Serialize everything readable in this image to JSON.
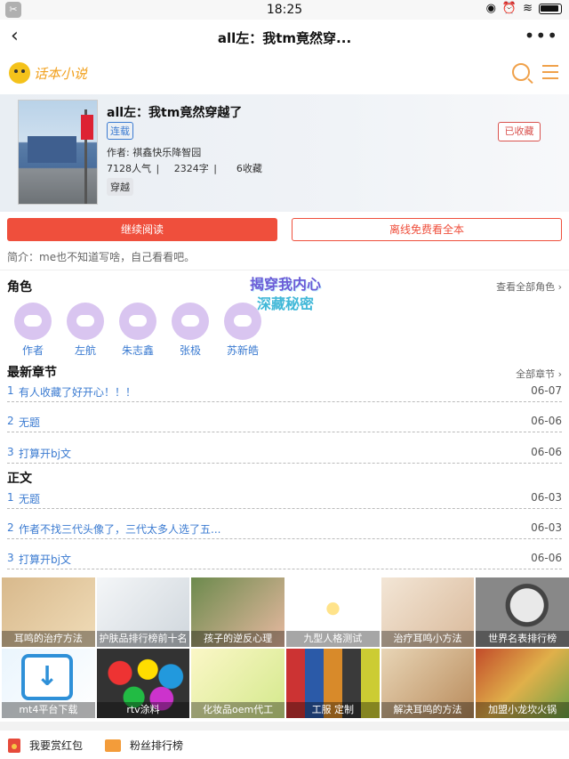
{
  "status": {
    "time": "18:25"
  },
  "nav": {
    "title": "all左：我tm竟然穿..."
  },
  "site": {
    "logo_text": "话本小说"
  },
  "book": {
    "title": "all左：我tm竟然穿越了",
    "serial_tag": "连载",
    "author": "作者: 祺鑫快乐降智园",
    "popularity": "7128人气 |",
    "words": "2324字 |",
    "favorites": "6收藏",
    "genre_tag": "穿越",
    "fav_button": "已收藏"
  },
  "actions": {
    "read": "继续阅读",
    "offline": "离线免费看全本"
  },
  "intro": "简介：me也不知道写啥，自己看看吧。",
  "roles": {
    "heading": "角色",
    "link": "查看全部角色 ›",
    "items": [
      "作者",
      "左航",
      "朱志鑫",
      "张极",
      "苏新皓"
    ]
  },
  "watermark": {
    "line1": "揭穿我内心",
    "line2": "深藏秘密"
  },
  "latest": {
    "heading": "最新章节",
    "link": "全部章节 ›",
    "items": [
      {
        "num": "1",
        "title": "有人收藏了好开心！！！",
        "date": "06-07"
      },
      {
        "num": "2",
        "title": "无题",
        "date": "06-06"
      },
      {
        "num": "3",
        "title": "打算开bj文",
        "date": "06-06"
      }
    ]
  },
  "main_text": {
    "heading": "正文",
    "items": [
      {
        "num": "1",
        "title": "无题",
        "date": "06-03"
      },
      {
        "num": "2",
        "title": "作者不找三代头像了，三代太多人选了五...",
        "date": "06-03"
      },
      {
        "num": "3",
        "title": "打算开bj文",
        "date": "06-06"
      }
    ]
  },
  "ads": [
    "耳鸣的治疗方法",
    "护肤品排行榜前十名",
    "孩子的逆反心理",
    "九型人格测试",
    "治疗耳鸣小方法",
    "世界名表排行榜",
    "mt4平台下载",
    "rtv涂料",
    "化妆品oem代工",
    "工服 定制",
    "解决耳鸣的方法",
    "加盟小龙坎火锅"
  ],
  "bottom": {
    "red_packet": "我要赏红包",
    "fan_rank": "粉丝排行榜"
  }
}
